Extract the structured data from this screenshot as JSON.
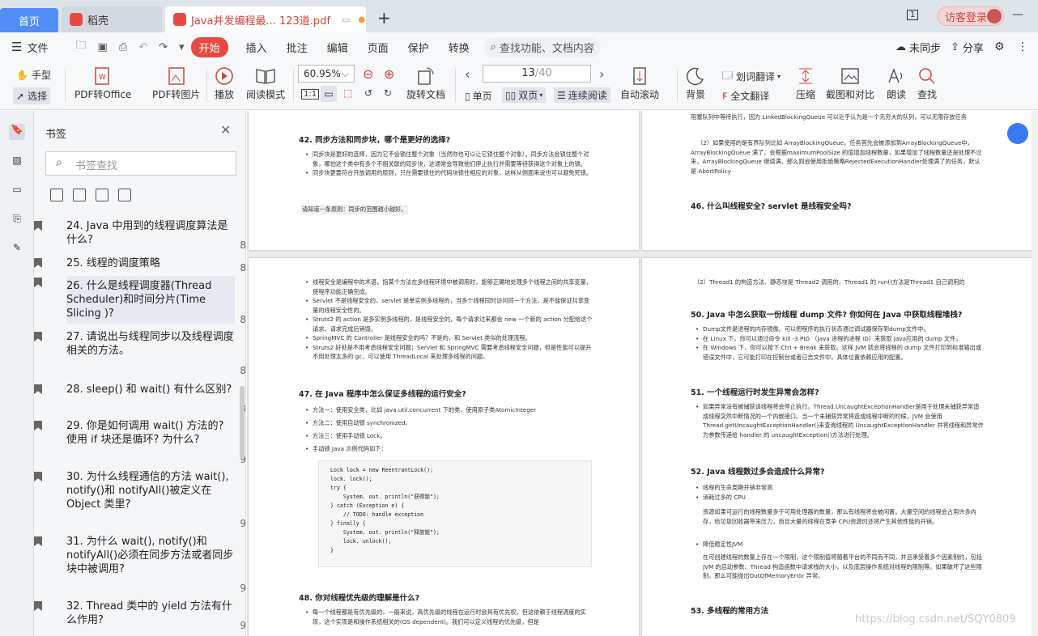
{
  "tabs": {
    "home": "首页",
    "daoke": "稻壳",
    "doc": "Java并发编程最... 123道.pdf"
  },
  "titlebar": {
    "page_badge": "1",
    "login": "访客登录"
  },
  "menu": {
    "file": "文件",
    "items": [
      "开始",
      "插入",
      "批注",
      "编辑",
      "页面",
      "保护",
      "转换"
    ],
    "search": "查找功能、文档内容",
    "sync": "未同步",
    "share": "分享"
  },
  "toolbar": {
    "hand": "手型",
    "select": "选择",
    "pdf_office": "PDF转Office",
    "pdf_image": "PDF转图片",
    "play": "播放",
    "read_mode": "阅读模式",
    "zoom": "60.95%",
    "rotate": "旋转文档",
    "page_current": "13",
    "page_total": "/40",
    "single": "单页",
    "double": "双页",
    "continuous": "连续阅读",
    "auto_scroll": "自动滚动",
    "background": "背景",
    "word_translate": "划词翻译",
    "full_translate": "全文翻译",
    "compress": "压缩",
    "screenshot": "截图和对比",
    "read_aloud": "朗读",
    "find": "查找"
  },
  "sidebar": {
    "title": "书签",
    "search_placeholder": "书签查找",
    "items": [
      {
        "text": "24. Java 中用到的线程调度算法是什么?",
        "page": "8"
      },
      {
        "text": "25. 线程的调度策略",
        "page": "8"
      },
      {
        "text": "26. 什么是线程调度器(Thread Scheduler)和时间分片(Time Slicing )?",
        "page": "8"
      },
      {
        "text": "27. 请说出与线程同步以及线程调度相关的方法。",
        "page": "8"
      },
      {
        "text": "28. sleep() 和 wait() 有什么区别?",
        "page": "8"
      },
      {
        "text": "29. 你是如何调用 wait() 方法的? 使用 if 块还是循环? 为什么?",
        "page": "9"
      },
      {
        "text": "30. 为什么线程通信的方法 wait(), notify()和 notifyAll()被定义在 Object 类里?",
        "page": "9"
      },
      {
        "text": "31. 为什么 wait(), notify()和 notifyAll()必须在同步方法或者同步块中被调用?",
        "page": "9"
      },
      {
        "text": "32. Thread 类中的 yield 方法有什么作用?",
        "page": "9"
      }
    ]
  },
  "pages": {
    "p1_heading": "42. 同步方法和同步块，哪个是更好的选择?",
    "p1_b1": "同步块是更好的选择，因为它不会锁住整个对象（当然你也可以让它锁住整个对象）。同步方法会锁住整个对象，哪怕这个类中有多个不相关联的同步块，这通常会导致他们停止执行并需要等待获得这个对象上的锁。",
    "p1_b2": "同步块更要符合开放调用的原则，只在需要锁住的代码块锁住相应的对象，这样从侧面来说也可以避免死锁。",
    "p1_note": "请知道一条原则：同步的范围越小越好。",
    "p2_top": "阻塞队列中等待执行，因为 LinkedBlockingQueue 可以近乎认为是一个无穷大的队列，可以无限存放任务",
    "p2_p2": "（2）如果使用的是有界队列比如 ArrayBlockingQueue，任务首先会被添加到ArrayBlockingQueue中，ArrayBlockingQueue 满了，会根据maximumPoolSize 的值增加线程数量，如果增加了线程数量还是处理不过来，ArrayBlockingQueue 继续满，那么则会使用拒绝策略RejectedExecutionHandler处理满了的任务，默认是 AbortPolicy",
    "p2_heading": "46. 什么叫线程安全? servlet 是线程安全吗?",
    "p3_b1": "线程安全是编程中的术语，指某个方法在多线程环境中被调用时，能够正确地处理多个线程之间的共享变量，使程序功能正确完成。",
    "p3_b2": "Servlet 不是线程安全的，servlet 是单实例多线程的，当多个线程同时访问同一个方法，是不能保证共享变量的线程安全性的。",
    "p3_b3": "Struts2 的 action 是多实例多线程的，是线程安全的，每个请求过来都会 new 一个新的 action 分配给这个请求，请求完成后销毁。",
    "p3_b4": "SpringMVC 的 Controller 是线程安全的吗？不是的，和 Servlet 类似的处理流程。",
    "p3_b5": "Struts2 好处是不用考虑线程安全问题；Servlet 和 SpringMVC 需要考虑线程安全问题，但是性能可以提升不用处理太多的 gc，可以使用 ThreadLocal 来处理多线程的问题。",
    "p3_heading47": "47. 在 Java 程序中怎么保证多线程的运行安全?",
    "p3_m1": "方法一：使用安全类，比如 java.util.concurrent 下的类，使用原子类AtomicInteger",
    "p3_m2": "方法二：使用自动锁 synchronized。",
    "p3_m3": "方法三：使用手动锁 Lock。",
    "p3_m4": "手动锁 Java 示例代码如下：",
    "p3_code": "Lock lock = new ReentrantLock();\nlock. lock();\ntry {\n    System. out. println(\"获得锁\");\n} catch (Exception e) {\n    // TODO: handle exception\n} finally {\n    System. out. println(\"释放锁\");\n    lock. unlock();\n}",
    "p3_heading48": "48. 你对线程优先级的理解是什么?",
    "p3_b48": "每一个线程都是有优先级的，一般来说，高优先级的线程在运行时会具有优先权，但这依赖于线程调度的实现，这个实现是和操作系统相关的(OS dependent)。我们可以定义线程的优先级，但是",
    "p4_top": "（2）Thread1 的构造方法、静态块是 Thread2 调用的，Thread1 的 run()方法是Thread1 自己调用的",
    "p4_h50": "50. Java 中怎么获取一份线程 dump 文件? 你如何在 Java 中获取线程堆栈?",
    "p4_b50a": "Dump文件是进程的内存镜像。可以把程序的执行状态通过调试器保存到dump文件中。",
    "p4_b50b": "在 Linux 下，你可以通过命令 kill -3 PID （Java 进程的进程 ID）来获取 Java应用的 dump 文件。",
    "p4_b50c": "在 Windows 下，你可以按下 Ctrl + Break 来获取。这样 JVM 就会将线程的 dump 文件打印到标准输出或错误文件中，它可能打印在控制台或者日志文件中，具体位置依赖应用的配置。",
    "p4_h51": "51. 一个线程运行时发生异常会怎样?",
    "p4_b51": "如果异常没有被捕获该线程将会停止执行。Thread.UncaughtExceptionHandler是用于处理未捕获异常造成线程突然中断情况的一个内嵌接口。当一个未捕获异常将造成线程中断的时候，JVM 会使用 Thread.getUncaughtExceptionHandler()来查询线程的 UncaughtExceptionHandler 并将线程和异常作为参数传递给 handler 的 uncaughtException()方法进行处理。",
    "p4_h52": "52. Java 线程数过多会造成什么异常?",
    "p4_b52a": "线程的生命周期开销非常高",
    "p4_b52b": "消耗过多的 CPU",
    "p4_b52b_d": "资源如果可运行的线程数量多于可用处理器的数量，那么有线程将会被闲置。大量空闲的线程会占用许多内存，给垃圾回收器带来压力，而且大量的线程在竞争 CPU资源时还将产生其他性能的开销。",
    "p4_b52c": "降低稳定性JVM",
    "p4_b52c_d": "在可创建线程的数量上存在一个限制，这个限制值将随着平台的不同而不同，并且承受着多个因素制约，包括 JVM 的启动参数、Thread 构造函数中请求栈的大小，以及底层操作系统对线程的限制等。如果破坏了这些限制，那么可能抛出OutOfMemoryError 异常。",
    "p4_h53": "53. 多线程的常用方法"
  },
  "watermark": "https://blog.csdn.net/SQY0809"
}
